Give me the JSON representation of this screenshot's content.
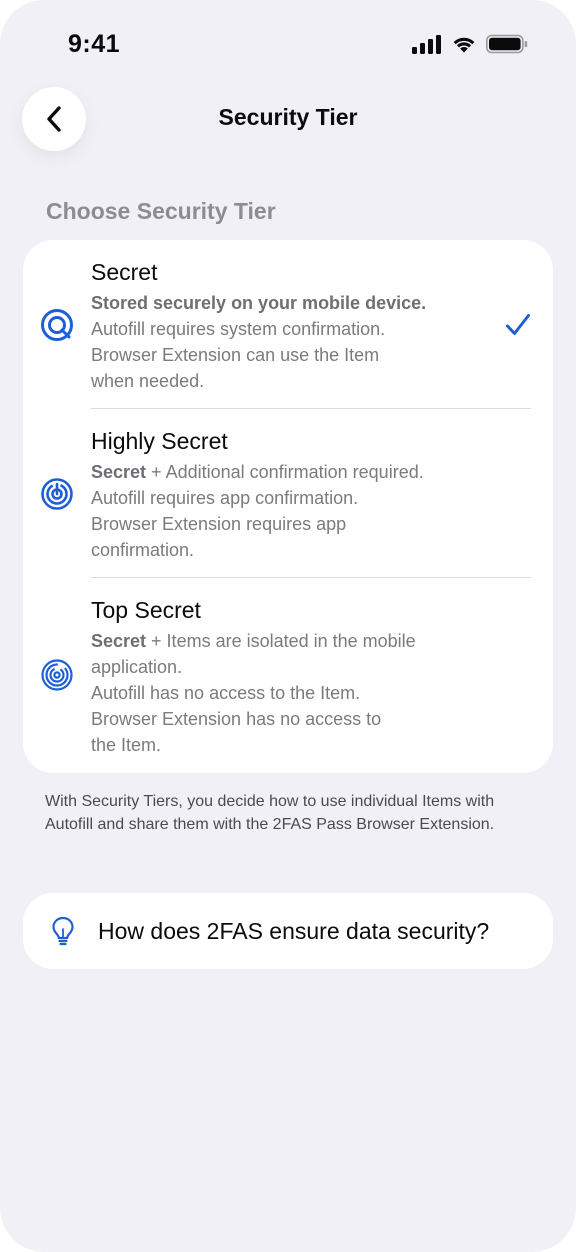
{
  "status_bar": {
    "time": "9:41",
    "icons": [
      "cellular-signal-icon",
      "wifi-icon",
      "battery-icon"
    ]
  },
  "nav": {
    "back_icon": "chevron-left-icon",
    "title": "Security Tier"
  },
  "section_label": "Choose Security Tier",
  "tiers": [
    {
      "icon": "tier-secret-icon",
      "title": "Secret",
      "lines": [
        {
          "bold": "Stored securely on your mobile device.",
          "rest": ""
        },
        {
          "bold": "",
          "rest": "Autofill requires system confirmation."
        },
        {
          "bold": "",
          "rest": "Browser Extension can use the Item"
        },
        {
          "bold": "",
          "rest": "when needed."
        }
      ],
      "selected": true
    },
    {
      "icon": "tier-highly-secret-icon",
      "title": "Highly Secret",
      "lines": [
        {
          "bold": "Secret",
          "rest": " + Additional confirmation required."
        },
        {
          "bold": "",
          "rest": "Autofill requires app confirmation."
        },
        {
          "bold": "",
          "rest": "Browser Extension requires app"
        },
        {
          "bold": "",
          "rest": "confirmation."
        }
      ],
      "selected": false
    },
    {
      "icon": "tier-top-secret-icon",
      "title": "Top Secret",
      "lines": [
        {
          "bold": "Secret",
          "rest": " + Items are isolated in the mobile"
        },
        {
          "bold": "",
          "rest": "application."
        },
        {
          "bold": "",
          "rest": "Autofill has no access to the Item."
        },
        {
          "bold": "",
          "rest": "Browser Extension has no access to"
        },
        {
          "bold": "",
          "rest": "the Item."
        }
      ],
      "selected": false
    }
  ],
  "selected_indicator_icon": "checkmark-icon",
  "footnote": "With Security Tiers, you decide how to use individual Items with Autofill and share them with the 2FAS Pass Browser Extension.",
  "help_link": {
    "icon": "lightbulb-icon",
    "label": "How does 2FAS ensure data security?"
  },
  "colors": {
    "accent": "#1f5fd6",
    "background": "#f1f0f6",
    "card": "#ffffff",
    "secondary_text": "#7b7a80"
  }
}
